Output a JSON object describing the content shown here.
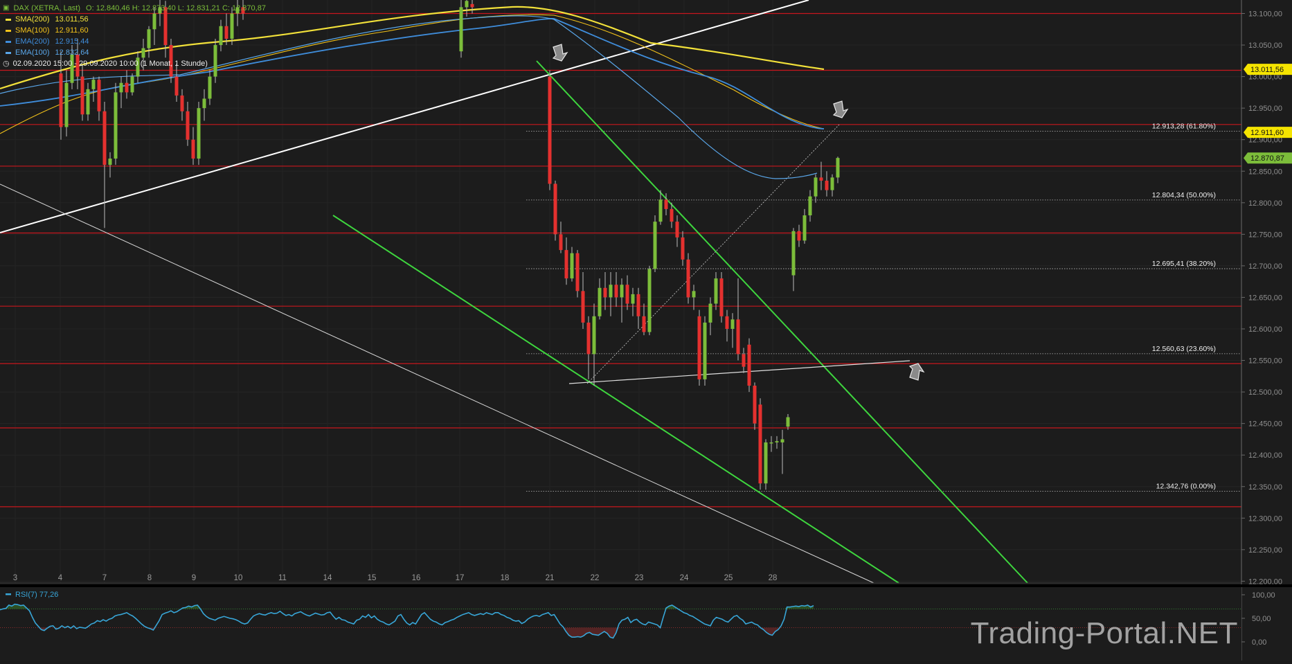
{
  "header": {
    "symbol": "DAX (XETRA, Last)",
    "ohlc": "O: 12.840,46   H: 12.873,40   L: 12.831,21   C: 12.870,87",
    "range": "02.09.2020 15:00 - 29.09.2020 10:00   (1 Monat, 1 Stunde)"
  },
  "legend": [
    {
      "name": "SMA(200)",
      "value": "13.011,56",
      "color": "#f2e13a"
    },
    {
      "name": "SMA(100)",
      "value": "12.911,60",
      "color": "#f2c21a"
    },
    {
      "name": "EMA(200)",
      "value": "12.915,44",
      "color": "#3f8ddb"
    },
    {
      "name": "EMA(100)",
      "value": "12.832,64",
      "color": "#5aa7ea"
    }
  ],
  "chart_data": {
    "type": "candlestick",
    "instrument": "DAX (XETRA, Last)",
    "y_range": [
      12190,
      13125
    ],
    "y_ticks": [
      13100,
      13050,
      13000,
      12950,
      12900,
      12850,
      12800,
      12750,
      12700,
      12650,
      12600,
      12550,
      12500,
      12450,
      12400,
      12350,
      12300,
      12250,
      12200
    ],
    "y_tick_labels": [
      "13.100,00",
      "13.050,00",
      "13.000,00",
      "12.950,00",
      "12.900,00",
      "12.850,00",
      "12.800,00",
      "12.750,00",
      "12.700,00",
      "12.650,00",
      "12.600,00",
      "12.550,00",
      "12.500,00",
      "12.450,00",
      "12.400,00",
      "12.350,00",
      "12.300,00",
      "12.250,00",
      "12.200,00"
    ],
    "x_labels": [
      "3",
      "4",
      "7",
      "8",
      "9",
      "10",
      "11",
      "14",
      "15",
      "16",
      "17",
      "18",
      "21",
      "22",
      "23",
      "24",
      "25",
      "28"
    ],
    "price_tags": [
      {
        "label": "13.011,56",
        "value": 13011.56,
        "color": "#f5e400",
        "text_color": "#111111"
      },
      {
        "label": "12.911,60",
        "value": 12911.6,
        "color": "#f5e400",
        "text_color": "#111111"
      },
      {
        "label": "12.870,87",
        "value": 12870.87,
        "color": "#7cbd3a",
        "text_color": "#111111"
      }
    ],
    "fibonacci": [
      {
        "label": "12.913,28 (61.80%)",
        "value": 12913.28
      },
      {
        "label": "12.804,34 (50.00%)",
        "value": 12804.34
      },
      {
        "label": "12.695,41 (38.20%)",
        "value": 12695.41
      },
      {
        "label": "12.560,63 (23.60%)",
        "value": 12560.63
      },
      {
        "label": "12.342,76 (0.00%)",
        "value": 12342.76
      }
    ],
    "horizontal_levels": [
      13100,
      13010,
      12924,
      12858,
      12752,
      12636,
      12545,
      12443,
      12318
    ],
    "candles": [
      {
        "o": 13005,
        "h": 13040,
        "l": 12900,
        "c": 12920
      },
      {
        "o": 12920,
        "h": 13010,
        "l": 12905,
        "c": 12990
      },
      {
        "o": 12990,
        "h": 13050,
        "l": 12980,
        "c": 13035
      },
      {
        "o": 13035,
        "h": 13060,
        "l": 12980,
        "c": 13000
      },
      {
        "o": 13000,
        "h": 13020,
        "l": 12930,
        "c": 12940
      },
      {
        "o": 12940,
        "h": 12990,
        "l": 12930,
        "c": 12980
      },
      {
        "o": 12980,
        "h": 13000,
        "l": 12960,
        "c": 12995
      },
      {
        "o": 12995,
        "h": 13000,
        "l": 12930,
        "c": 12945
      },
      {
        "o": 12945,
        "h": 12960,
        "l": 12760,
        "c": 12860
      },
      {
        "o": 12860,
        "h": 12880,
        "l": 12840,
        "c": 12870
      },
      {
        "o": 12870,
        "h": 12990,
        "l": 12860,
        "c": 12975
      },
      {
        "o": 12975,
        "h": 13000,
        "l": 12950,
        "c": 12990
      },
      {
        "o": 12990,
        "h": 13010,
        "l": 12965,
        "c": 12975
      },
      {
        "o": 12975,
        "h": 13005,
        "l": 12970,
        "c": 13000
      },
      {
        "o": 13000,
        "h": 13040,
        "l": 12990,
        "c": 13030
      },
      {
        "o": 13030,
        "h": 13060,
        "l": 13010,
        "c": 13045
      },
      {
        "o": 13045,
        "h": 13080,
        "l": 13030,
        "c": 13075
      },
      {
        "o": 13075,
        "h": 13110,
        "l": 13050,
        "c": 13100
      },
      {
        "o": 13100,
        "h": 13125,
        "l": 13080,
        "c": 13110
      },
      {
        "o": 13110,
        "h": 13120,
        "l": 13030,
        "c": 13050
      },
      {
        "o": 13050,
        "h": 13060,
        "l": 12990,
        "c": 13000
      },
      {
        "o": 13000,
        "h": 13020,
        "l": 12960,
        "c": 12970
      },
      {
        "o": 12970,
        "h": 12980,
        "l": 12930,
        "c": 12945
      },
      {
        "o": 12945,
        "h": 12960,
        "l": 12890,
        "c": 12900
      },
      {
        "o": 12900,
        "h": 12920,
        "l": 12860,
        "c": 12870
      },
      {
        "o": 12870,
        "h": 12960,
        "l": 12860,
        "c": 12950
      },
      {
        "o": 12950,
        "h": 12980,
        "l": 12930,
        "c": 12965
      },
      {
        "o": 12965,
        "h": 13010,
        "l": 12955,
        "c": 13000
      },
      {
        "o": 13000,
        "h": 13060,
        "l": 12990,
        "c": 13050
      },
      {
        "o": 13050,
        "h": 13090,
        "l": 13040,
        "c": 13080
      },
      {
        "o": 13080,
        "h": 13100,
        "l": 13050,
        "c": 13060
      },
      {
        "o": 13060,
        "h": 13110,
        "l": 13050,
        "c": 13100
      },
      {
        "o": 13100,
        "h": 13125,
        "l": 13080,
        "c": 13110
      },
      {
        "o": 13110,
        "h": 13125,
        "l": 13090,
        "c": 13100
      },
      {
        "o": 13040,
        "h": 13125,
        "l": 13030,
        "c": 13110
      },
      {
        "o": 13110,
        "h": 13125,
        "l": 13095,
        "c": 13120
      },
      {
        "o": 13115,
        "h": 13125,
        "l": 13100,
        "c": 13110
      },
      {
        "o": 13000,
        "h": 13010,
        "l": 12820,
        "c": 12830
      },
      {
        "o": 12830,
        "h": 12835,
        "l": 12740,
        "c": 12750
      },
      {
        "o": 12750,
        "h": 12770,
        "l": 12720,
        "c": 12725
      },
      {
        "o": 12725,
        "h": 12745,
        "l": 12670,
        "c": 12680
      },
      {
        "o": 12680,
        "h": 12730,
        "l": 12675,
        "c": 12720
      },
      {
        "o": 12720,
        "h": 12725,
        "l": 12650,
        "c": 12660
      },
      {
        "o": 12660,
        "h": 12690,
        "l": 12600,
        "c": 12610
      },
      {
        "o": 12610,
        "h": 12620,
        "l": 12520,
        "c": 12560
      },
      {
        "o": 12560,
        "h": 12640,
        "l": 12510,
        "c": 12620
      },
      {
        "o": 12620,
        "h": 12680,
        "l": 12615,
        "c": 12665
      },
      {
        "o": 12665,
        "h": 12690,
        "l": 12630,
        "c": 12650
      },
      {
        "o": 12650,
        "h": 12690,
        "l": 12620,
        "c": 12670
      },
      {
        "o": 12670,
        "h": 12690,
        "l": 12635,
        "c": 12650
      },
      {
        "o": 12650,
        "h": 12680,
        "l": 12610,
        "c": 12670
      },
      {
        "o": 12670,
        "h": 12685,
        "l": 12630,
        "c": 12640
      },
      {
        "o": 12640,
        "h": 12665,
        "l": 12620,
        "c": 12655
      },
      {
        "o": 12655,
        "h": 12665,
        "l": 12600,
        "c": 12620
      },
      {
        "o": 12620,
        "h": 12640,
        "l": 12590,
        "c": 12595
      },
      {
        "o": 12595,
        "h": 12700,
        "l": 12590,
        "c": 12695
      },
      {
        "o": 12695,
        "h": 12780,
        "l": 12690,
        "c": 12770
      },
      {
        "o": 12770,
        "h": 12820,
        "l": 12765,
        "c": 12805
      },
      {
        "o": 12805,
        "h": 12815,
        "l": 12780,
        "c": 12790
      },
      {
        "o": 12790,
        "h": 12800,
        "l": 12760,
        "c": 12770
      },
      {
        "o": 12770,
        "h": 12780,
        "l": 12730,
        "c": 12745
      },
      {
        "o": 12745,
        "h": 12755,
        "l": 12700,
        "c": 12710
      },
      {
        "o": 12710,
        "h": 12720,
        "l": 12640,
        "c": 12650
      },
      {
        "o": 12650,
        "h": 12670,
        "l": 12630,
        "c": 12660
      },
      {
        "o": 12620,
        "h": 12630,
        "l": 12510,
        "c": 12520
      },
      {
        "o": 12520,
        "h": 12620,
        "l": 12510,
        "c": 12610
      },
      {
        "o": 12610,
        "h": 12650,
        "l": 12590,
        "c": 12640
      },
      {
        "o": 12640,
        "h": 12690,
        "l": 12630,
        "c": 12680
      },
      {
        "o": 12680,
        "h": 12690,
        "l": 12610,
        "c": 12620
      },
      {
        "o": 12620,
        "h": 12630,
        "l": 12580,
        "c": 12600
      },
      {
        "o": 12600,
        "h": 12625,
        "l": 12570,
        "c": 12615
      },
      {
        "o": 12615,
        "h": 12680,
        "l": 12550,
        "c": 12560
      },
      {
        "o": 12560,
        "h": 12570,
        "l": 12530,
        "c": 12540
      },
      {
        "o": 12575,
        "h": 12585,
        "l": 12500,
        "c": 12510
      },
      {
        "o": 12510,
        "h": 12515,
        "l": 12440,
        "c": 12450
      },
      {
        "o": 12480,
        "h": 12490,
        "l": 12345,
        "c": 12355
      },
      {
        "o": 12355,
        "h": 12425,
        "l": 12345,
        "c": 12420
      },
      {
        "o": 12420,
        "h": 12430,
        "l": 12405,
        "c": 12420
      },
      {
        "o": 12420,
        "h": 12430,
        "l": 12410,
        "c": 12422
      },
      {
        "o": 12420,
        "h": 12440,
        "l": 12370,
        "c": 12425
      },
      {
        "o": 12445,
        "h": 12465,
        "l": 12440,
        "c": 12460
      },
      {
        "o": 12685,
        "h": 12760,
        "l": 12660,
        "c": 12755
      },
      {
        "o": 12755,
        "h": 12765,
        "l": 12730,
        "c": 12740
      },
      {
        "o": 12740,
        "h": 12790,
        "l": 12735,
        "c": 12780
      },
      {
        "o": 12780,
        "h": 12820,
        "l": 12770,
        "c": 12810
      },
      {
        "o": 12810,
        "h": 12845,
        "l": 12800,
        "c": 12840
      },
      {
        "o": 12840,
        "h": 12865,
        "l": 12820,
        "c": 12835
      },
      {
        "o": 12835,
        "h": 12850,
        "l": 12810,
        "c": 12820
      },
      {
        "o": 12820,
        "h": 12845,
        "l": 12810,
        "c": 12840
      },
      {
        "o": 12840,
        "h": 12873,
        "l": 12831,
        "c": 12871
      }
    ],
    "rsi": {
      "label": "RSI(7)",
      "value": "77,26",
      "y_range": [
        0,
        110
      ],
      "ticks": [
        "100,00",
        "50,00",
        "0,00"
      ],
      "overbought": 70,
      "oversold": 30,
      "values": [
        68,
        70,
        71,
        78,
        76,
        80,
        79,
        77,
        78,
        72,
        66,
        52,
        40,
        33,
        26,
        24,
        29,
        33,
        34,
        27,
        29,
        34,
        30,
        33,
        29,
        34,
        28,
        31,
        30,
        29,
        33,
        38,
        40,
        45,
        43,
        47,
        44,
        48,
        50,
        55,
        57,
        58,
        60,
        62,
        58,
        55,
        50,
        44,
        38,
        33,
        30,
        28,
        25,
        35,
        45,
        58,
        61,
        63,
        66,
        62,
        64,
        68,
        72,
        73,
        76,
        74,
        77,
        78,
        70,
        60,
        54,
        50,
        48,
        46,
        50,
        52,
        54,
        52,
        50,
        49,
        47,
        44,
        40,
        38,
        40,
        48,
        55,
        58,
        60,
        58,
        57,
        60,
        62,
        60,
        61,
        65,
        60,
        56,
        58,
        55,
        60,
        62,
        64,
        60,
        57,
        55,
        58,
        61,
        59,
        57,
        58,
        62,
        63,
        55,
        48,
        52,
        47,
        46,
        42,
        40,
        38,
        46,
        48,
        55,
        52,
        58,
        51,
        55,
        48,
        44,
        42,
        38,
        36,
        40,
        44,
        55,
        58,
        48,
        40,
        36,
        41,
        38,
        48,
        58,
        62,
        55,
        48,
        44,
        42,
        38,
        36,
        41,
        43,
        46,
        48,
        52,
        55,
        58,
        60,
        62,
        58,
        56,
        58,
        60,
        58,
        62,
        60,
        58,
        62,
        62,
        58,
        56,
        52,
        50,
        46,
        44,
        45,
        39,
        42,
        48,
        52,
        55,
        56,
        54,
        58,
        60,
        62,
        56,
        58,
        48,
        38,
        32,
        22,
        14,
        10,
        10,
        11,
        10,
        13,
        18,
        20,
        16,
        15,
        14,
        18,
        22,
        18,
        10,
        8,
        19,
        38,
        46,
        48,
        52,
        41,
        46,
        48,
        42,
        38,
        36,
        42,
        40,
        38,
        36,
        30,
        52,
        72,
        76,
        78,
        74,
        70,
        66,
        62,
        60,
        56,
        54,
        50,
        46,
        42,
        38,
        36,
        34,
        46,
        52,
        50,
        48,
        44,
        42,
        48,
        54,
        56,
        50,
        46,
        38,
        40,
        42,
        38,
        36,
        30,
        26,
        20,
        16,
        14,
        22,
        26,
        34,
        48,
        74,
        74,
        75,
        76,
        75,
        77,
        76,
        78,
        74,
        77
      ]
    }
  },
  "watermark": "Trading-Portal.NET"
}
